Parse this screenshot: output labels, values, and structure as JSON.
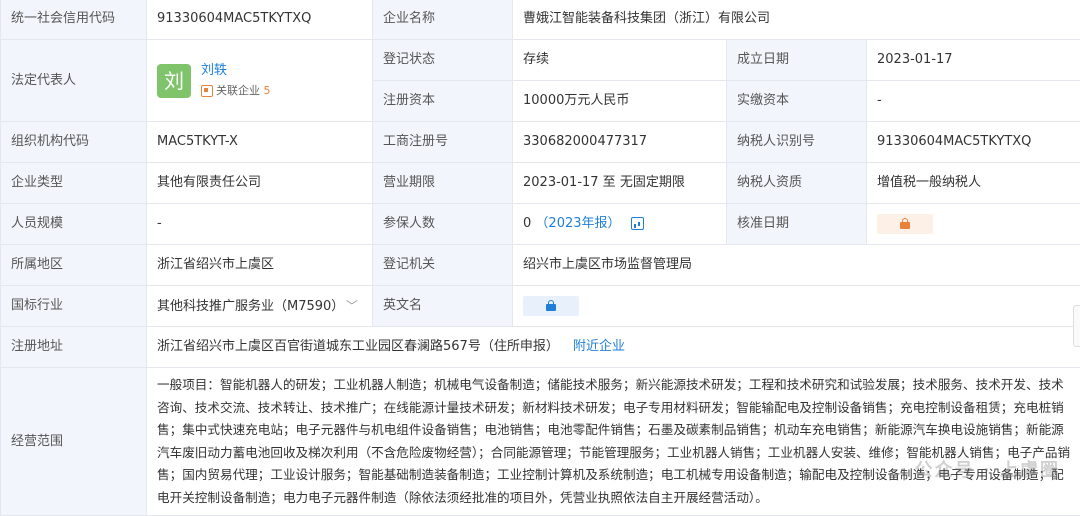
{
  "labels": {
    "credit_code": "统一社会信用代码",
    "company_name": "企业名称",
    "legal_rep": "法定代表人",
    "reg_status": "登记状态",
    "established": "成立日期",
    "reg_capital": "注册资本",
    "paid_capital": "实缴资本",
    "org_code": "组织机构代码",
    "biz_reg_no": "工商注册号",
    "taxpayer_id": "纳税人识别号",
    "company_type": "企业类型",
    "biz_term": "营业期限",
    "taxpayer_qual": "纳税人资质",
    "staff_size": "人员规模",
    "insured": "参保人数",
    "approval_date": "核准日期",
    "region": "所属地区",
    "reg_authority": "登记机关",
    "industry": "国标行业",
    "english_name": "英文名",
    "reg_address": "注册地址",
    "scope": "经营范围"
  },
  "values": {
    "credit_code": "91330604MAC5TKYTXQ",
    "company_name": "曹娥江智能装备科技集团（浙江）有限公司",
    "legal_rep_name": "刘轶",
    "legal_rep_avatar": "刘",
    "assoc_label": "关联企业",
    "assoc_count": "5",
    "reg_status": "存续",
    "established": "2023-01-17",
    "reg_capital": "10000万元人民币",
    "paid_capital": "-",
    "org_code": "MAC5TKYT-X",
    "biz_reg_no": "330682000477317",
    "taxpayer_id": "91330604MAC5TKYTXQ",
    "company_type": "其他有限责任公司",
    "biz_term": "2023-01-17 至 无固定期限",
    "taxpayer_qual": "增值税一般纳税人",
    "staff_size": "-",
    "insured_count": "0",
    "insured_report": "（2023年报）",
    "region": "浙江省绍兴市上虞区",
    "reg_authority": "绍兴市上虞区市场监督管理局",
    "industry": "其他科技推广服务业（M7590）",
    "reg_address": "浙江省绍兴市上虞区百官街道城东工业园区春澜路567号（住所申报）",
    "nearby": "附近企业",
    "scope": "一般项目：智能机器人的研发；工业机器人制造；机械电气设备制造；储能技术服务；新兴能源技术研发；工程和技术研究和试验发展；技术服务、技术开发、技术咨询、技术交流、技术转让、技术推广；在线能源计量技术研发；新材料技术研发；电子专用材料研发；智能输配电及控制设备销售；充电控制设备租赁；充电桩销售；集中式快速充电站；电子元器件与机电组件设备销售；电池销售；电池零配件销售；石墨及碳素制品销售；机动车充电销售；新能源汽车换电设施销售；新能源汽车废旧动力蓄电池回收及梯次利用（不含危险废物经营）；合同能源管理；节能管理服务；工业机器人销售；工业机器人安装、维修；智能机器人销售；电子产品销售；国内贸易代理；工业设计服务；智能基础制造装备制造；工业控制计算机及系统制造；电工机械专用设备制造；输配电及控制设备制造；电子专用设备制造；配电开关控制设备制造；电力电子元器件制造（除依法须经批准的项目外，凭营业执照依法自主开展经营活动）。"
  },
  "icons": {
    "lock": "lock-icon",
    "chart": "report-chart-icon",
    "chevron": "chevron-down-icon",
    "assoc": "related-company-icon"
  },
  "colors": {
    "label_bg": "#f2f6fc",
    "link": "#1f7fd8",
    "accent": "#e8823a",
    "avatar": "#7fc36b"
  },
  "watermark": "公众号 · 上虞圈"
}
